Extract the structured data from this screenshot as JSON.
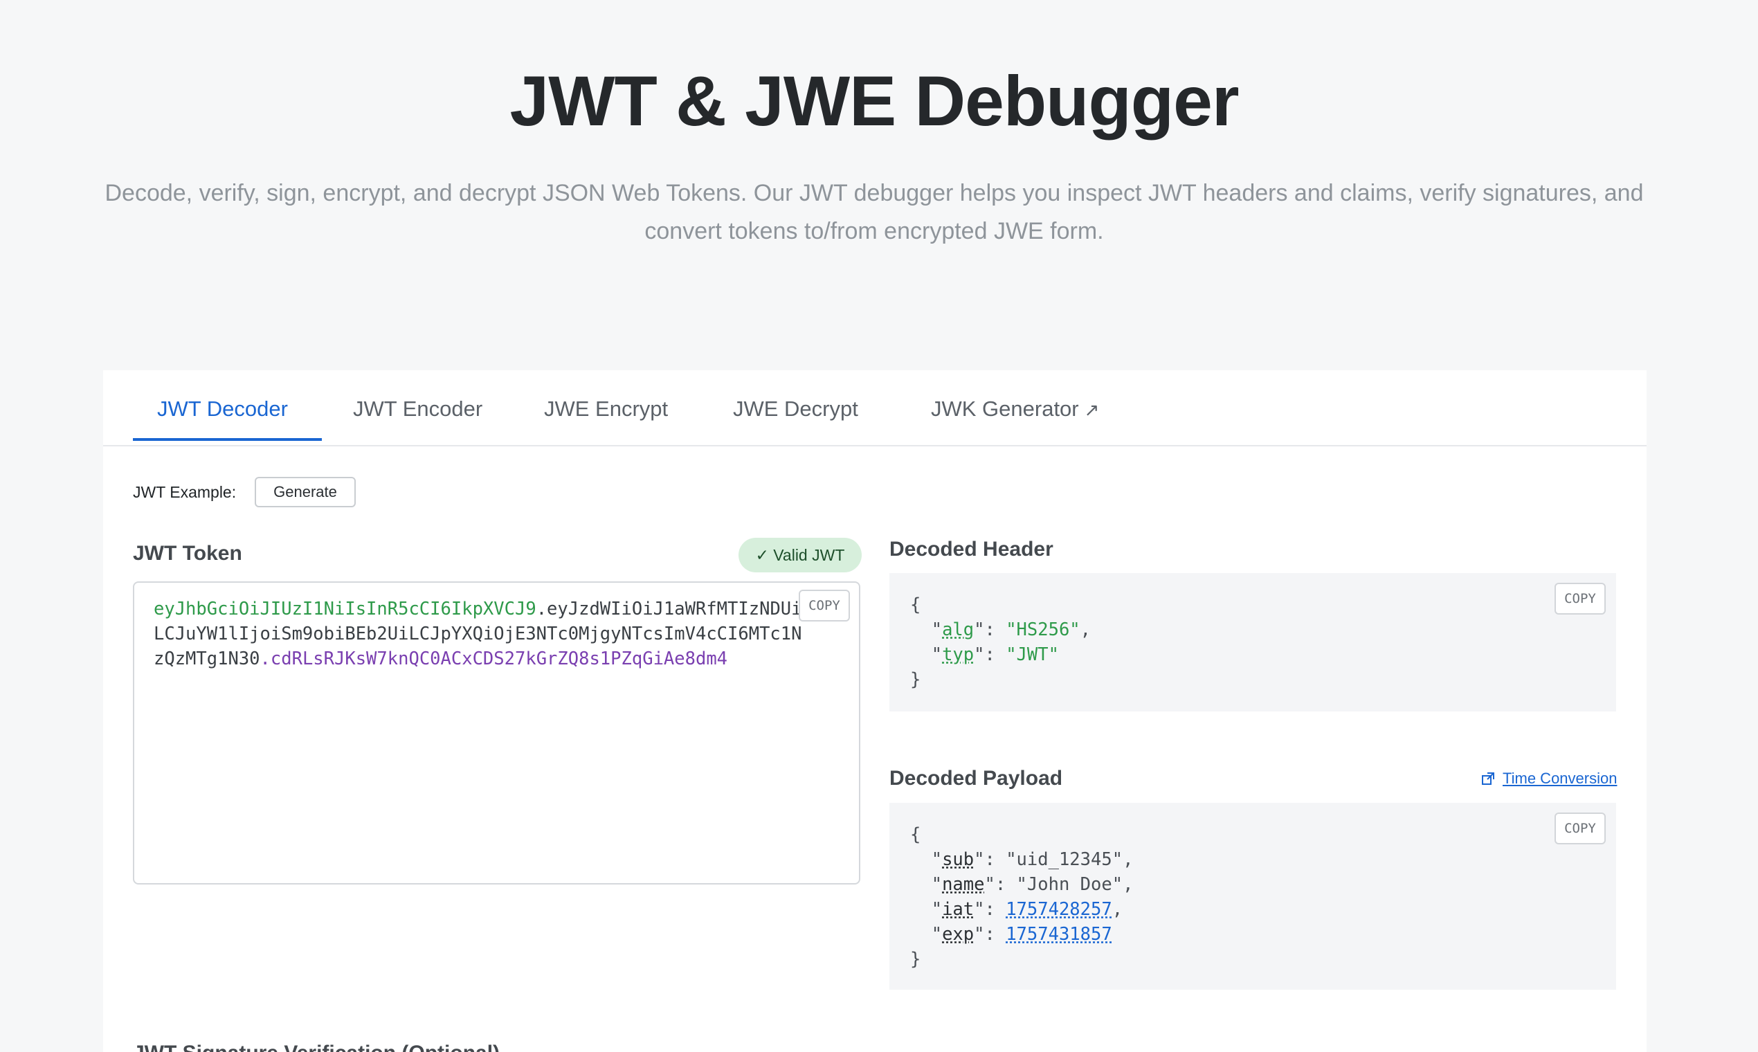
{
  "page": {
    "title": "JWT & JWE Debugger",
    "subtitle": "Decode, verify, sign, encrypt, and decrypt JSON Web Tokens. Our JWT debugger helps you inspect JWT headers and claims, verify signatures, and convert tokens to/from encrypted JWE form."
  },
  "tabs": [
    {
      "label": "JWT Decoder",
      "active": true
    },
    {
      "label": "JWT Encoder",
      "active": false
    },
    {
      "label": "JWE Encrypt",
      "active": false
    },
    {
      "label": "JWE Decrypt",
      "active": false
    },
    {
      "label": "JWK Generator",
      "active": false,
      "icon": "external-link-icon",
      "icon_glyph": "↗"
    }
  ],
  "example": {
    "label": "JWT Example:",
    "button": "Generate"
  },
  "token": {
    "title": "JWT Token",
    "badge": "✓ Valid JWT",
    "header_part": "eyJhbGciOiJIUzI1NiIsInR5cCI6IkpXVCJ9",
    "dot1": ".",
    "payload_part": "eyJzdWIiOiJ1aWRfMTIzNDUiLCJuYW1lIjoiSm9obiBEb2UiLCJpYXQiOjE3NTc0MjgyNTcsImV4cCI6MTc1NzQzMTg1N30",
    "dot2": ".",
    "signature_part": "cdRLsRJKsW7knQC0ACxCDS27kGrZQ8s1PZqGiAe8dm4",
    "copy": "COPY"
  },
  "decoded_header": {
    "title": "Decoded Header",
    "copy": "COPY",
    "alg_key": "alg",
    "alg_val": "\"HS256\"",
    "typ_key": "typ",
    "typ_val": "\"JWT\""
  },
  "decoded_payload": {
    "title": "Decoded Payload",
    "copy": "COPY",
    "link": "Time Conversion",
    "sub_key": "sub",
    "sub_val": "\"uid_12345\"",
    "name_key": "name",
    "name_val": "\"John Doe\"",
    "iat_key": "iat",
    "iat_val": "1757428257",
    "exp_key": "exp",
    "exp_val": "1757431857"
  },
  "next_section": {
    "title": "JWT Signature Verification (Optional)"
  },
  "colors": {
    "accent": "#1a66d2",
    "header_green": "#2e9a4a",
    "signature_purple": "#7a3fb0",
    "badge_bg": "#d7efdc"
  }
}
